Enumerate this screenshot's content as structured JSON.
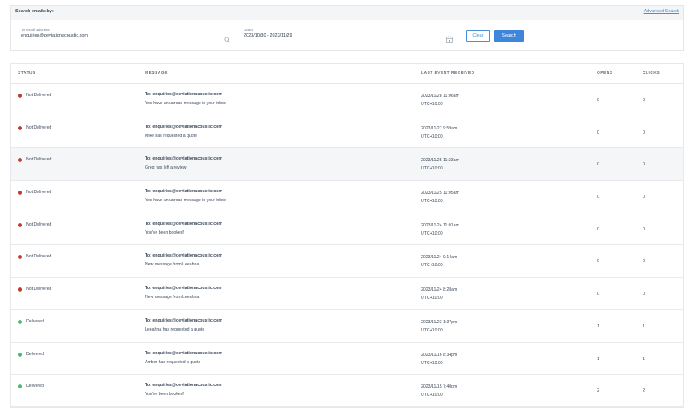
{
  "search": {
    "title": "Search emails by:",
    "advanced_link": "Advanced Search",
    "to_label": "To email address",
    "to_value": "enquiries@deviationacoustic.com",
    "dates_label": "Dates",
    "dates_value": "2023/10/30 - 2023/11/29",
    "clear_label": "Clear",
    "search_label": "Search"
  },
  "table": {
    "headers": {
      "status": "STATUS",
      "message": "MESSAGE",
      "last_event": "LAST EVENT RECEIVED",
      "opens": "OPENS",
      "clicks": "CLICKS"
    },
    "rows": [
      {
        "status": "Not Delivered",
        "to": "To: enquiries@deviationacoustic.com",
        "subject": "You have an unread message in your inbox",
        "date": "2023/11/28 11:06am",
        "tz": "UTC+10:00",
        "opens": "0",
        "clicks": "0"
      },
      {
        "status": "Not Delivered",
        "to": "To: enquiries@deviationacoustic.com",
        "subject": "Mike has requested a quote",
        "date": "2023/11/27 9:59am",
        "tz": "UTC+10:00",
        "opens": "0",
        "clicks": "0"
      },
      {
        "status": "Not Delivered",
        "to": "To: enquiries@deviationacoustic.com",
        "subject": "Greg has left a review",
        "date": "2023/11/25 11:23am",
        "tz": "UTC+10:00",
        "opens": "0",
        "clicks": "0"
      },
      {
        "status": "Not Delivered",
        "to": "To: enquiries@deviationacoustic.com",
        "subject": "You have an unread message in your inbox",
        "date": "2023/11/25 11:05am",
        "tz": "UTC+10:00",
        "opens": "0",
        "clicks": "0"
      },
      {
        "status": "Not Delivered",
        "to": "To: enquiries@deviationacoustic.com",
        "subject": "You've been booked!",
        "date": "2023/11/24 11:01am",
        "tz": "UTC+10:00",
        "opens": "0",
        "clicks": "0"
      },
      {
        "status": "Not Delivered",
        "to": "To: enquiries@deviationacoustic.com",
        "subject": "New message from Leeahna",
        "date": "2023/11/24 9:14am",
        "tz": "UTC+10:00",
        "opens": "0",
        "clicks": "0"
      },
      {
        "status": "Not Delivered",
        "to": "To: enquiries@deviationacoustic.com",
        "subject": "New message from Leeahna",
        "date": "2023/11/24 8:28am",
        "tz": "UTC+10:00",
        "opens": "0",
        "clicks": "0"
      },
      {
        "status": "Delivered",
        "to": "To: enquiries@deviationacoustic.com",
        "subject": "Leeahna has requested a quote",
        "date": "2023/11/23 1:37pm",
        "tz": "UTC+10:00",
        "opens": "1",
        "clicks": "1"
      },
      {
        "status": "Delivered",
        "to": "To: enquiries@deviationacoustic.com",
        "subject": "Amber has requested a quote",
        "date": "2023/11/16 8:34pm",
        "tz": "UTC+10:00",
        "opens": "1",
        "clicks": "1"
      },
      {
        "status": "Delivered",
        "to": "To: enquiries@deviationacoustic.com",
        "subject": "You've been booked!",
        "date": "2023/11/15 7:40pm",
        "tz": "UTC+10:00",
        "opens": "2",
        "clicks": "2"
      }
    ]
  },
  "colors": {
    "not_delivered": "#c0392b",
    "delivered": "#4cb86b",
    "accent": "#3d86db"
  },
  "icons": {
    "to_search": "search-icon",
    "dates": "calendar-icon"
  }
}
